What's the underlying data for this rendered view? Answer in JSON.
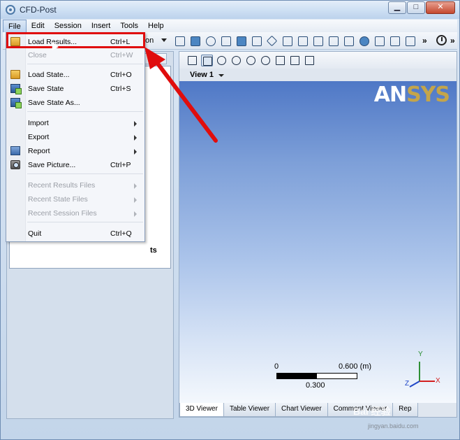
{
  "window": {
    "title": "CFD-Post"
  },
  "menubar": {
    "items": [
      {
        "label": "File"
      },
      {
        "label": "Edit"
      },
      {
        "label": "Session"
      },
      {
        "label": "Insert"
      },
      {
        "label": "Tools"
      },
      {
        "label": "Help"
      }
    ]
  },
  "toolbar": {
    "partial_label": "on",
    "overflow": "»"
  },
  "file_menu": {
    "items": [
      {
        "label": "Load Results...",
        "shortcut": "Ctrl+L"
      },
      {
        "label": "Close",
        "shortcut": "Ctrl+W"
      },
      {
        "label": "Load State...",
        "shortcut": "Ctrl+O"
      },
      {
        "label": "Save State",
        "shortcut": "Ctrl+S"
      },
      {
        "label": "Save State As..."
      },
      {
        "label": "Import"
      },
      {
        "label": "Export"
      },
      {
        "label": "Report"
      },
      {
        "label": "Save Picture...",
        "shortcut": "Ctrl+P"
      },
      {
        "label": "Recent Results Files"
      },
      {
        "label": "Recent State Files"
      },
      {
        "label": "Recent Session Files"
      },
      {
        "label": "Quit",
        "shortcut": "Ctrl+Q"
      }
    ]
  },
  "left_panel": {
    "partial_text": "ts"
  },
  "viewer": {
    "view_label": "View 1",
    "logo_white": "AN",
    "logo_gold": "SYS",
    "scale": {
      "min": "0",
      "max": "0.600",
      "unit": "(m)",
      "mid": "0.300"
    },
    "axes": {
      "y": "Y",
      "x": "X",
      "z": "Z"
    },
    "tabs": [
      {
        "label": "3D Viewer"
      },
      {
        "label": "Table Viewer"
      },
      {
        "label": "Chart Viewer"
      },
      {
        "label": "Comment Viewer"
      },
      {
        "label": "Rep"
      }
    ]
  },
  "watermark": {
    "text": "Bai 经验",
    "sub": "jingyan.baidu.com"
  },
  "colors": {
    "highlight": "#e00d0d",
    "accent": "#4f78c6"
  }
}
